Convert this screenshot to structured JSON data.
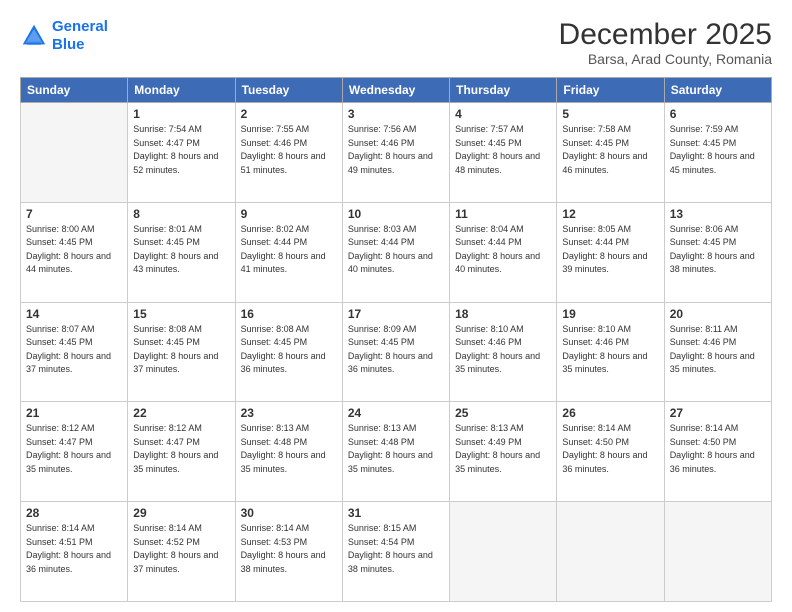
{
  "header": {
    "logo_line1": "General",
    "logo_line2": "Blue",
    "title": "December 2025",
    "subtitle": "Barsa, Arad County, Romania"
  },
  "days_of_week": [
    "Sunday",
    "Monday",
    "Tuesday",
    "Wednesday",
    "Thursday",
    "Friday",
    "Saturday"
  ],
  "weeks": [
    [
      {
        "num": "",
        "sunrise": "",
        "sunset": "",
        "daylight": ""
      },
      {
        "num": "1",
        "sunrise": "Sunrise: 7:54 AM",
        "sunset": "Sunset: 4:47 PM",
        "daylight": "Daylight: 8 hours and 52 minutes."
      },
      {
        "num": "2",
        "sunrise": "Sunrise: 7:55 AM",
        "sunset": "Sunset: 4:46 PM",
        "daylight": "Daylight: 8 hours and 51 minutes."
      },
      {
        "num": "3",
        "sunrise": "Sunrise: 7:56 AM",
        "sunset": "Sunset: 4:46 PM",
        "daylight": "Daylight: 8 hours and 49 minutes."
      },
      {
        "num": "4",
        "sunrise": "Sunrise: 7:57 AM",
        "sunset": "Sunset: 4:45 PM",
        "daylight": "Daylight: 8 hours and 48 minutes."
      },
      {
        "num": "5",
        "sunrise": "Sunrise: 7:58 AM",
        "sunset": "Sunset: 4:45 PM",
        "daylight": "Daylight: 8 hours and 46 minutes."
      },
      {
        "num": "6",
        "sunrise": "Sunrise: 7:59 AM",
        "sunset": "Sunset: 4:45 PM",
        "daylight": "Daylight: 8 hours and 45 minutes."
      }
    ],
    [
      {
        "num": "7",
        "sunrise": "Sunrise: 8:00 AM",
        "sunset": "Sunset: 4:45 PM",
        "daylight": "Daylight: 8 hours and 44 minutes."
      },
      {
        "num": "8",
        "sunrise": "Sunrise: 8:01 AM",
        "sunset": "Sunset: 4:45 PM",
        "daylight": "Daylight: 8 hours and 43 minutes."
      },
      {
        "num": "9",
        "sunrise": "Sunrise: 8:02 AM",
        "sunset": "Sunset: 4:44 PM",
        "daylight": "Daylight: 8 hours and 41 minutes."
      },
      {
        "num": "10",
        "sunrise": "Sunrise: 8:03 AM",
        "sunset": "Sunset: 4:44 PM",
        "daylight": "Daylight: 8 hours and 40 minutes."
      },
      {
        "num": "11",
        "sunrise": "Sunrise: 8:04 AM",
        "sunset": "Sunset: 4:44 PM",
        "daylight": "Daylight: 8 hours and 40 minutes."
      },
      {
        "num": "12",
        "sunrise": "Sunrise: 8:05 AM",
        "sunset": "Sunset: 4:44 PM",
        "daylight": "Daylight: 8 hours and 39 minutes."
      },
      {
        "num": "13",
        "sunrise": "Sunrise: 8:06 AM",
        "sunset": "Sunset: 4:45 PM",
        "daylight": "Daylight: 8 hours and 38 minutes."
      }
    ],
    [
      {
        "num": "14",
        "sunrise": "Sunrise: 8:07 AM",
        "sunset": "Sunset: 4:45 PM",
        "daylight": "Daylight: 8 hours and 37 minutes."
      },
      {
        "num": "15",
        "sunrise": "Sunrise: 8:08 AM",
        "sunset": "Sunset: 4:45 PM",
        "daylight": "Daylight: 8 hours and 37 minutes."
      },
      {
        "num": "16",
        "sunrise": "Sunrise: 8:08 AM",
        "sunset": "Sunset: 4:45 PM",
        "daylight": "Daylight: 8 hours and 36 minutes."
      },
      {
        "num": "17",
        "sunrise": "Sunrise: 8:09 AM",
        "sunset": "Sunset: 4:45 PM",
        "daylight": "Daylight: 8 hours and 36 minutes."
      },
      {
        "num": "18",
        "sunrise": "Sunrise: 8:10 AM",
        "sunset": "Sunset: 4:46 PM",
        "daylight": "Daylight: 8 hours and 35 minutes."
      },
      {
        "num": "19",
        "sunrise": "Sunrise: 8:10 AM",
        "sunset": "Sunset: 4:46 PM",
        "daylight": "Daylight: 8 hours and 35 minutes."
      },
      {
        "num": "20",
        "sunrise": "Sunrise: 8:11 AM",
        "sunset": "Sunset: 4:46 PM",
        "daylight": "Daylight: 8 hours and 35 minutes."
      }
    ],
    [
      {
        "num": "21",
        "sunrise": "Sunrise: 8:12 AM",
        "sunset": "Sunset: 4:47 PM",
        "daylight": "Daylight: 8 hours and 35 minutes."
      },
      {
        "num": "22",
        "sunrise": "Sunrise: 8:12 AM",
        "sunset": "Sunset: 4:47 PM",
        "daylight": "Daylight: 8 hours and 35 minutes."
      },
      {
        "num": "23",
        "sunrise": "Sunrise: 8:13 AM",
        "sunset": "Sunset: 4:48 PM",
        "daylight": "Daylight: 8 hours and 35 minutes."
      },
      {
        "num": "24",
        "sunrise": "Sunrise: 8:13 AM",
        "sunset": "Sunset: 4:48 PM",
        "daylight": "Daylight: 8 hours and 35 minutes."
      },
      {
        "num": "25",
        "sunrise": "Sunrise: 8:13 AM",
        "sunset": "Sunset: 4:49 PM",
        "daylight": "Daylight: 8 hours and 35 minutes."
      },
      {
        "num": "26",
        "sunrise": "Sunrise: 8:14 AM",
        "sunset": "Sunset: 4:50 PM",
        "daylight": "Daylight: 8 hours and 36 minutes."
      },
      {
        "num": "27",
        "sunrise": "Sunrise: 8:14 AM",
        "sunset": "Sunset: 4:50 PM",
        "daylight": "Daylight: 8 hours and 36 minutes."
      }
    ],
    [
      {
        "num": "28",
        "sunrise": "Sunrise: 8:14 AM",
        "sunset": "Sunset: 4:51 PM",
        "daylight": "Daylight: 8 hours and 36 minutes."
      },
      {
        "num": "29",
        "sunrise": "Sunrise: 8:14 AM",
        "sunset": "Sunset: 4:52 PM",
        "daylight": "Daylight: 8 hours and 37 minutes."
      },
      {
        "num": "30",
        "sunrise": "Sunrise: 8:14 AM",
        "sunset": "Sunset: 4:53 PM",
        "daylight": "Daylight: 8 hours and 38 minutes."
      },
      {
        "num": "31",
        "sunrise": "Sunrise: 8:15 AM",
        "sunset": "Sunset: 4:54 PM",
        "daylight": "Daylight: 8 hours and 38 minutes."
      },
      {
        "num": "",
        "sunrise": "",
        "sunset": "",
        "daylight": ""
      },
      {
        "num": "",
        "sunrise": "",
        "sunset": "",
        "daylight": ""
      },
      {
        "num": "",
        "sunrise": "",
        "sunset": "",
        "daylight": ""
      }
    ]
  ]
}
